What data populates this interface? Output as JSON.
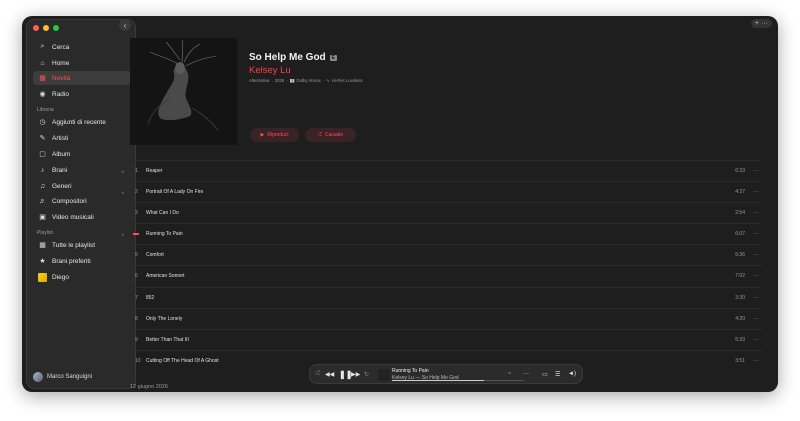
{
  "sidebar": {
    "items": [
      {
        "label": "Cerca",
        "icon": "search-icon",
        "glyph": "⌕"
      },
      {
        "label": "Home",
        "icon": "home-icon",
        "glyph": "⌂"
      },
      {
        "label": "Novità",
        "icon": "grid-icon",
        "glyph": "▦"
      },
      {
        "label": "Radio",
        "icon": "radio-icon",
        "glyph": "◉"
      }
    ],
    "library_label": "Libreria",
    "library_items": [
      {
        "label": "Aggiunti di recente",
        "icon": "clock-icon",
        "glyph": "◷"
      },
      {
        "label": "Artisti",
        "icon": "microphone-icon",
        "glyph": "✎"
      },
      {
        "label": "Album",
        "icon": "album-icon",
        "glyph": "▢"
      },
      {
        "label": "Brani",
        "icon": "note-icon",
        "glyph": "♪"
      },
      {
        "label": "Generi",
        "icon": "genres-icon",
        "glyph": "♫"
      },
      {
        "label": "Compositori",
        "icon": "composer-icon",
        "glyph": "♬"
      },
      {
        "label": "Video musicali",
        "icon": "video-icon",
        "glyph": "▣"
      }
    ],
    "playlist_label": "Playlist",
    "playlist_items": [
      {
        "label": "Tutte le playlist",
        "icon": "playlist-grid-icon",
        "glyph": "▦"
      },
      {
        "label": "Brani preferiti",
        "icon": "star-playlist-icon",
        "glyph": "★"
      },
      {
        "label": "Diego",
        "icon": "playlist-cover-icon",
        "glyph": ""
      }
    ],
    "user_name": "Marco Sanguigni"
  },
  "album": {
    "title": "So Help Me God",
    "explicit": "E",
    "artist": "Kelsey Lu",
    "genre": "Alternativa",
    "year": "2026",
    "dolby": "Dolby Atmos",
    "lossless": "Hi-Res Lossless",
    "play_label": "Riproduci",
    "shuffle_label": "Casuale",
    "release_date": "12 giugno 2026"
  },
  "tracks": [
    {
      "num": "1",
      "title": "Reaper",
      "duration": "6:33",
      "fav": true,
      "playing": false
    },
    {
      "num": "2",
      "title": "Portrait Of A Lady On Fire",
      "duration": "4:27",
      "fav": true,
      "playing": false
    },
    {
      "num": "3",
      "title": "What Can I Do",
      "duration": "2:54",
      "fav": false,
      "playing": false
    },
    {
      "num": "",
      "title": "Running To Pain",
      "duration": "6:07",
      "fav": true,
      "playing": true
    },
    {
      "num": "5",
      "title": "Comfort",
      "duration": "5:36",
      "fav": false,
      "playing": false
    },
    {
      "num": "6",
      "title": "American Sonnet",
      "duration": "7:02",
      "fav": false,
      "playing": false
    },
    {
      "num": "7",
      "title": "852",
      "duration": "3:30",
      "fav": false,
      "playing": false
    },
    {
      "num": "8",
      "title": "Only The Lonely",
      "duration": "4:20",
      "fav": false,
      "playing": false
    },
    {
      "num": "9",
      "title": "Better Than That III",
      "duration": "5:33",
      "fav": false,
      "playing": false
    },
    {
      "num": "10",
      "title": "Cutting Off The Head Of A Ghost",
      "duration": "3:51",
      "fav": false,
      "playing": false
    }
  ],
  "now_playing": {
    "title": "Running To Pain",
    "subtitle": "Kelsey Lu — So Help Me God",
    "progress": 0.7
  },
  "colors": {
    "accent": "#ff3b4f",
    "background": "#1e1e1e",
    "sidebar": "#2a2a2a"
  }
}
